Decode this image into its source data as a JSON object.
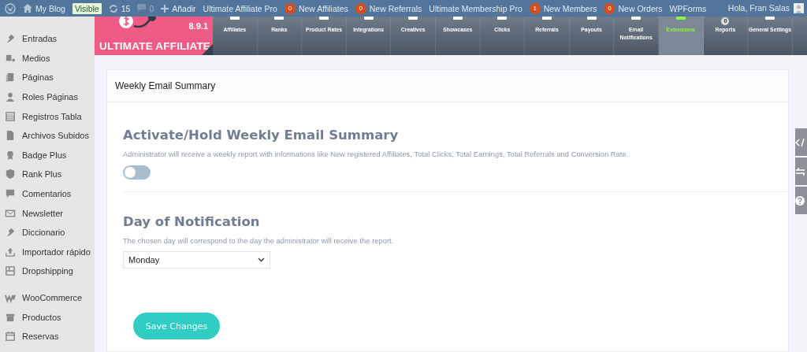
{
  "admin_bar": {
    "site": "My Blog",
    "visibility_badge": "Visible",
    "updates": "15",
    "comments": "0",
    "new_label": "Añadir",
    "items": [
      {
        "kind": "link",
        "label": "Ultimate Affiliate Pro"
      },
      {
        "kind": "counter",
        "count": "0",
        "label": "New Affiliates"
      },
      {
        "kind": "counter",
        "count": "0",
        "label": "New Referrals"
      },
      {
        "kind": "link",
        "label": "Ultimate Membership Pro"
      },
      {
        "kind": "counter",
        "count": "1",
        "label": "New Members"
      },
      {
        "kind": "counter",
        "count": "0",
        "label": "New Orders"
      },
      {
        "kind": "link",
        "label": "WPForms"
      }
    ],
    "greeting": "Hola, Fran Salas"
  },
  "sidebar": {
    "items": [
      "Entradas",
      "Medios",
      "Páginas",
      "Roles Páginas",
      "Registros Tabla",
      "Archivos Subidos",
      "Badge Plus",
      "Rank Plus",
      "Comentarios",
      "Newsletter",
      "Diccionario",
      "Importador rápido",
      "Dropshipping",
      "WooCommerce",
      "Productos",
      "Reservas"
    ]
  },
  "plugin_header": {
    "logo": "ULTIMATE AFFILIATE",
    "version": "8.9.1",
    "reports_badge": "0",
    "tabs": [
      {
        "label": "Affiliates",
        "selected": false
      },
      {
        "label": "Ranks",
        "selected": false
      },
      {
        "label": "Product Rates",
        "selected": false
      },
      {
        "label": "Integrations",
        "selected": false
      },
      {
        "label": "Creatives",
        "selected": false
      },
      {
        "label": "Showcases",
        "selected": false
      },
      {
        "label": "Clicks",
        "selected": false
      },
      {
        "label": "Referrals",
        "selected": false
      },
      {
        "label": "Payouts",
        "selected": false
      },
      {
        "label": "Email Notifications",
        "selected": false
      },
      {
        "label": "Extensions",
        "selected": true
      },
      {
        "label": "Reports",
        "selected": false
      },
      {
        "label": "General Settings",
        "selected": false
      }
    ]
  },
  "panel": {
    "title": "Weekly Email Summary",
    "activate": {
      "heading": "Activate/Hold Weekly Email Summary",
      "description": "Administrator will receive a weekly report with informations like New registered Affiliates, Total Clicks, Total Earnings, Total Referrals and Conversion Rate.",
      "on": false
    },
    "day": {
      "heading": "Day of Notification",
      "description": "The chosen day will correspond to the day the administrator will receive the report.",
      "value": "Monday"
    },
    "save_button": "Save Changes"
  }
}
